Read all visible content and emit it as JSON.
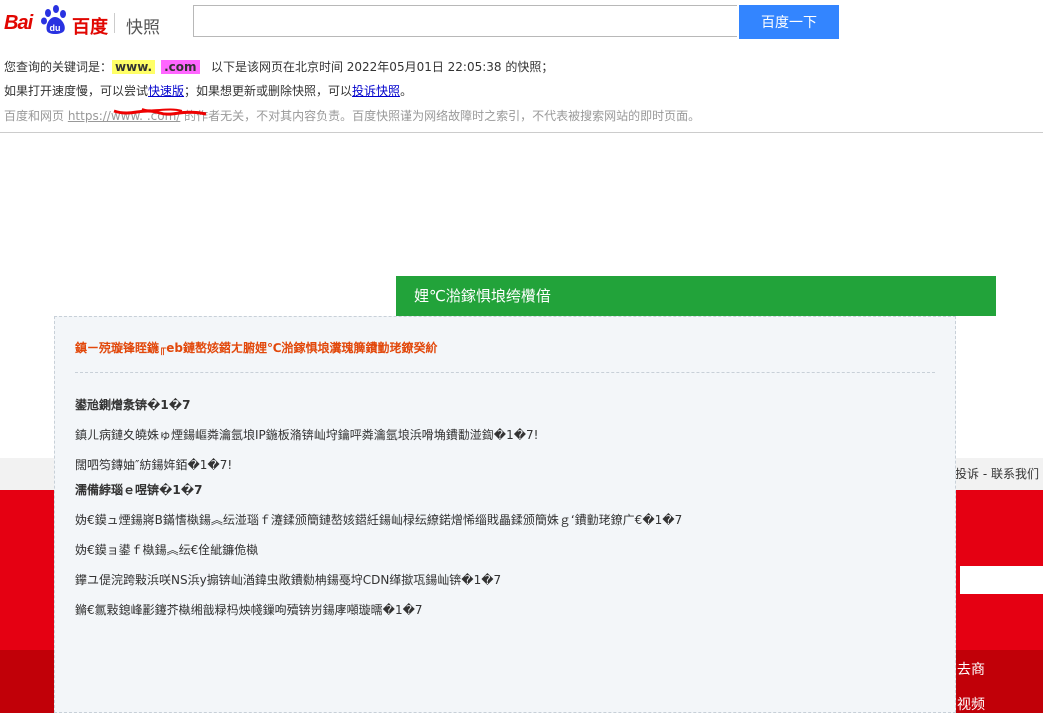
{
  "header": {
    "logo_bai": "Bai",
    "logo_du": "du",
    "logo_cn": "百度",
    "logo_kuaizhao": "快照",
    "search_value": "",
    "search_button": "百度一下"
  },
  "info": {
    "line1_prefix": "您查询的关键词是：",
    "keyword1": "www.",
    "keyword2": ".com",
    "line1_suffix": "以下是该网页在北京时间 2022年05月01日 22:05:38 的快照；",
    "line2_a": "如果打开速度慢，可以尝试",
    "line2_link1": "快速版",
    "line2_b": "；如果想更新或删除快照，可以",
    "line2_link2": "投诉快照",
    "line2_c": "。",
    "line3_a": "百度和网页 ",
    "line3_link": "https://www.        .com/",
    "line3_b": " 的作者无关，不对其内容负责。百度快照谨为网络故障时之索引，不代表被搜索网站的即时页面。"
  },
  "background": {
    "footer_text": "投诉 - 联系我们",
    "side_text1": "去商",
    "side_text2": "视频"
  },
  "banner": {
    "title": "娌℃湁鎵惧埌绔欑偣"
  },
  "panel": {
    "title": "鎮ㄧ殑璇锋眰鍦╓eb鏈嶅姟鍣ㄤ腑娌℃湁鎵惧埌瀵瑰簲鐨勭珯鐐癸紒",
    "lines": [
      {
        "text": "鍙兘鍘熷洜锛�1�7",
        "bold": true
      },
      {
        "text": "鎮ㄦ病鏈夊皢姝ゅ煙鍚嶇粦瀹氬埌IP鍦板潃锛屾垨鑰呯粦瀹氬埌浜嗗埆鐨勫湴鍧�1�7!",
        "bold": false
      },
      {
        "text": "闊呬笉鏄妯″紡鍚姩銆�1�7!",
        "bold": false
      },
      {
        "text": "濡備綍瑙ｅ喅锛�1�7",
        "bold": true
      },
      {
        "text": "妫€鏌ュ煙鍚嶈В鏋愭槸鍚︽纭湴瑙ｆ瀽鍒颁簡鏈嶅姟鍣紝鍚屾椂纭繚鍩熷悕缁戝畾鍒颁簡姝ｇ‘鐨勭珯鐐广€�1�7",
        "bold": false
      },
      {
        "text": "妫€鏌ョ鍙ｆ槸鍚︽纭€佺紪鐮佹槸",
        "bold": false
      },
      {
        "text": "鑻ユ偍浣跨敤浜咲NS浜у搧锛屾湭鍏虫敞鐨勬柟鍚戞垨CDN缂撳瓨鍚屾锛�1�7",
        "bold": false
      },
      {
        "text": "鏅€氱敤鎴峰彲鑳芥槸缃戠粶杩炴帴鏁呴殰锛岃鍚庨噸璇曘�1�7",
        "bold": false
      }
    ]
  },
  "colors": {
    "baidu_red": "#e10601",
    "search_blue": "#3385ff",
    "banner_green": "#22a33a",
    "panel_title_orange": "#e2480b"
  }
}
